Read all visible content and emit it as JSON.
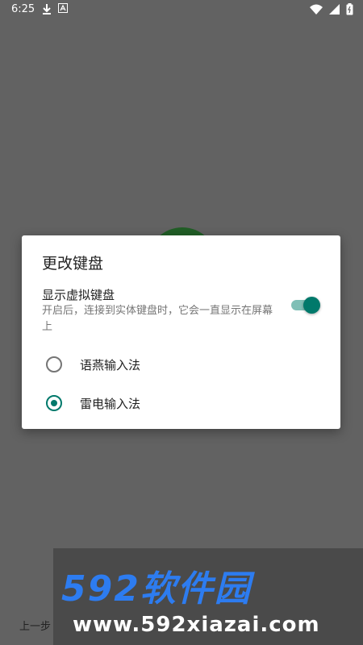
{
  "status_bar": {
    "time": "6:25",
    "left_icons": [
      "download-icon",
      "font-icon"
    ],
    "right_icons": [
      "wifi-icon",
      "signal-icon",
      "battery-icon"
    ]
  },
  "dialog": {
    "title": "更改键盘",
    "show_virtual_keyboard": {
      "title": "显示虚拟键盘",
      "summary": "开启后，连接到实体键盘时，它会一直显示在屏幕上",
      "enabled": true
    },
    "options": [
      {
        "label": "语燕输入法",
        "selected": false
      },
      {
        "label": "雷电输入法",
        "selected": true
      }
    ]
  },
  "nav": {
    "prev_label": "上一步"
  },
  "watermark": {
    "logo": "592软件园",
    "url": "www.592xiazai.com"
  },
  "colors": {
    "accent": "#00796b",
    "scrim": "#626262"
  }
}
